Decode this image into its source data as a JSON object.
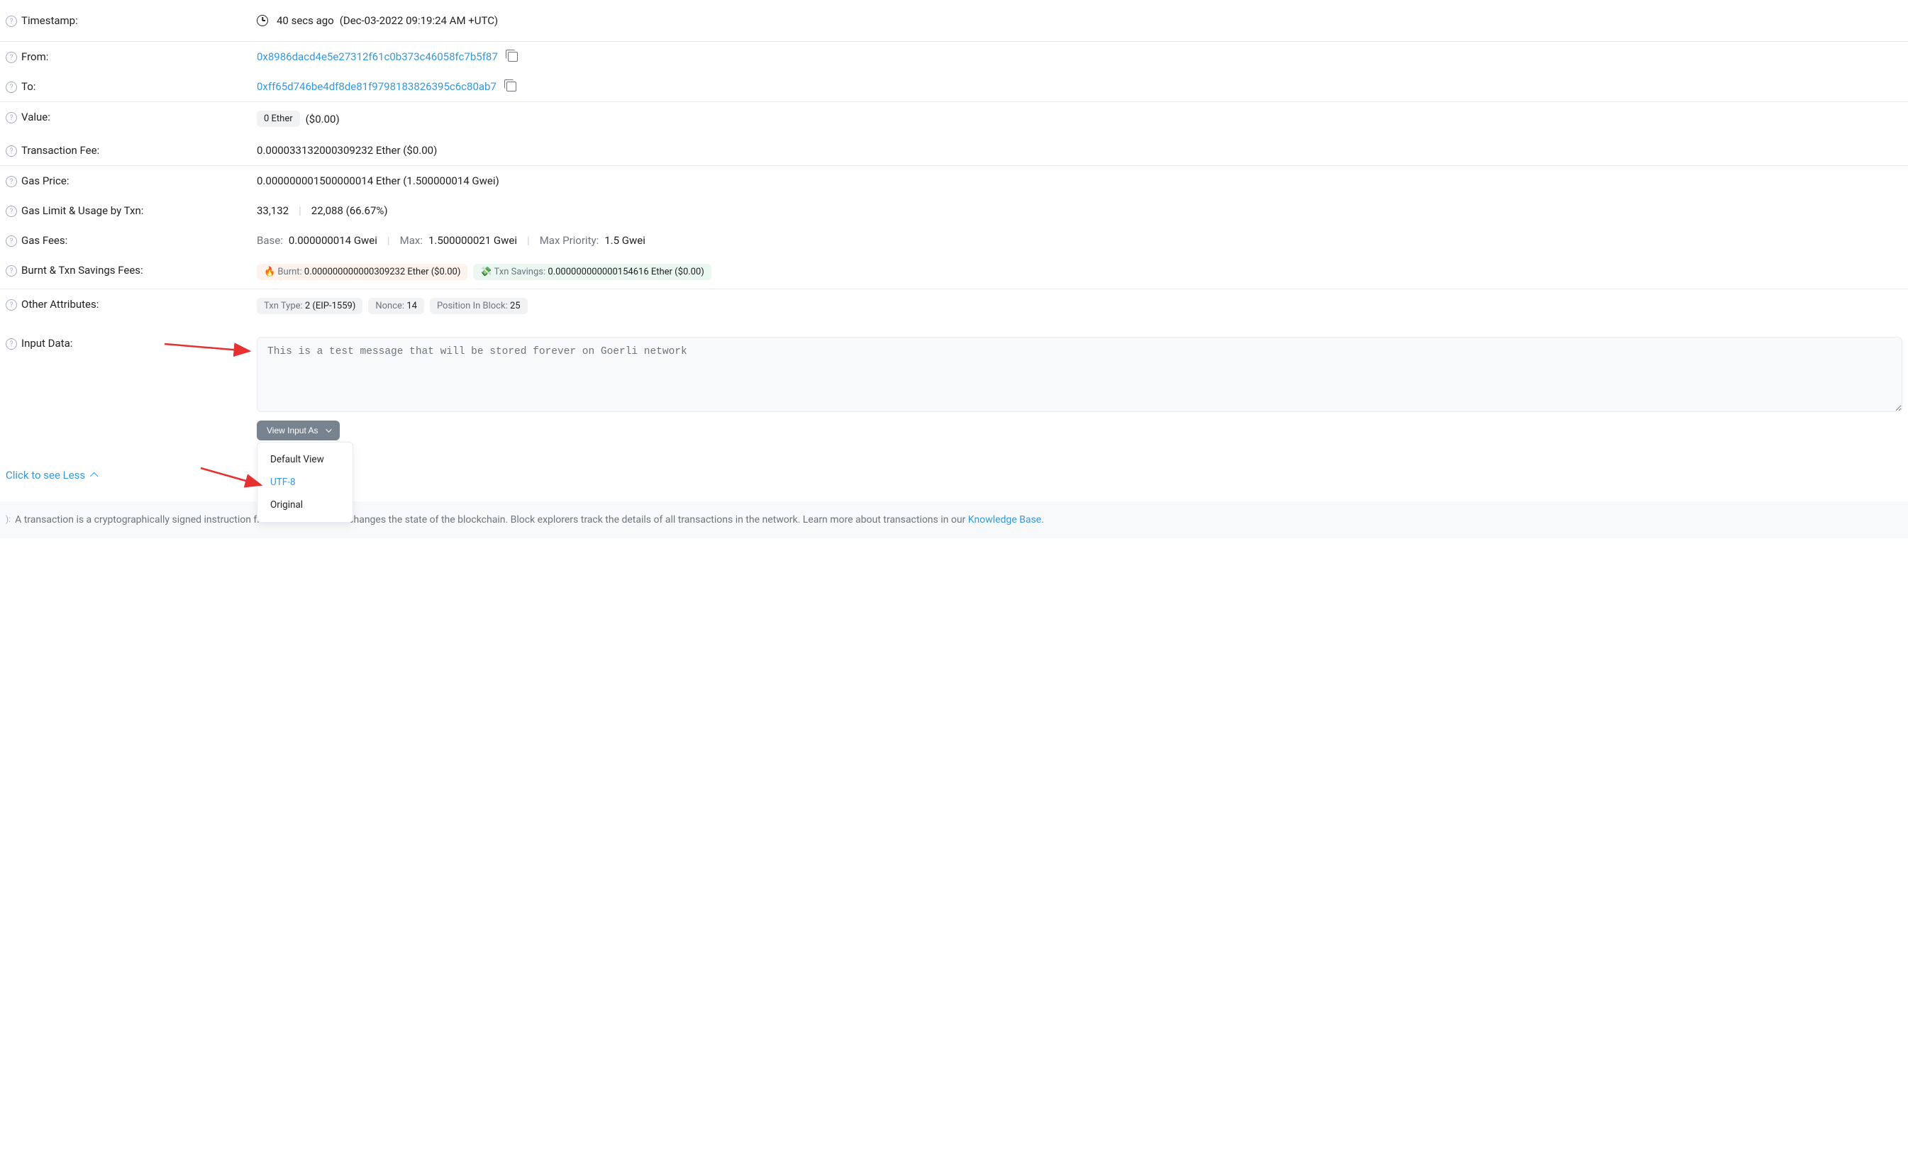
{
  "labels": {
    "timestamp": "Timestamp:",
    "from": "From:",
    "to": "To:",
    "value": "Value:",
    "txn_fee": "Transaction Fee:",
    "gas_price": "Gas Price:",
    "gas_limit_usage": "Gas Limit & Usage by Txn:",
    "gas_fees": "Gas Fees:",
    "burnt_savings": "Burnt & Txn Savings Fees:",
    "other_attrs": "Other Attributes:",
    "input_data": "Input Data:"
  },
  "timestamp": {
    "relative": "40 secs ago",
    "absolute": "(Dec-03-2022 09:19:24 AM +UTC)"
  },
  "from_address": "0x8986dacd4e5e27312f61c0b373c46058fc7b5f87",
  "to_address": "0xff65d746be4df8de81f9798183826395c6c80ab7",
  "value": {
    "eth": "0 Ether",
    "usd": "($0.00)"
  },
  "txn_fee": "0.000033132000309232 Ether ($0.00)",
  "gas_price": "0.000000001500000014 Ether (1.500000014 Gwei)",
  "gas_limit_usage": {
    "limit": "33,132",
    "usage": "22,088 (66.67%)"
  },
  "gas_fees": {
    "base_label": "Base:",
    "base_value": "0.000000014 Gwei",
    "max_label": "Max:",
    "max_value": "1.500000021 Gwei",
    "max_priority_label": "Max Priority:",
    "max_priority_value": "1.5 Gwei"
  },
  "burnt": {
    "burnt_label": "Burnt:",
    "burnt_value": "0.000000000000309232 Ether ($0.00)",
    "savings_label": "Txn Savings:",
    "savings_value": "0.000000000000154616 Ether ($0.00)"
  },
  "other_attrs": {
    "txn_type_label": "Txn Type:",
    "txn_type_value": "2 (EIP-1559)",
    "nonce_label": "Nonce:",
    "nonce_value": "14",
    "position_label": "Position In Block:",
    "position_value": "25"
  },
  "input_data_text": "This is a test message that will be stored forever on Goerli network",
  "view_input_as": {
    "button": "View Input As",
    "options": {
      "default": "Default View",
      "utf8": "UTF-8",
      "original": "Original"
    }
  },
  "see_less": "Click to see Less",
  "footer": {
    "text_prefix": "A transaction is a cryptographically signed instruction from an account that changes the state of the blockchain. Block explorers track the details of all transactions in the network. Learn more about transactions in our ",
    "link": "Knowledge Base",
    "text_suffix": "."
  }
}
